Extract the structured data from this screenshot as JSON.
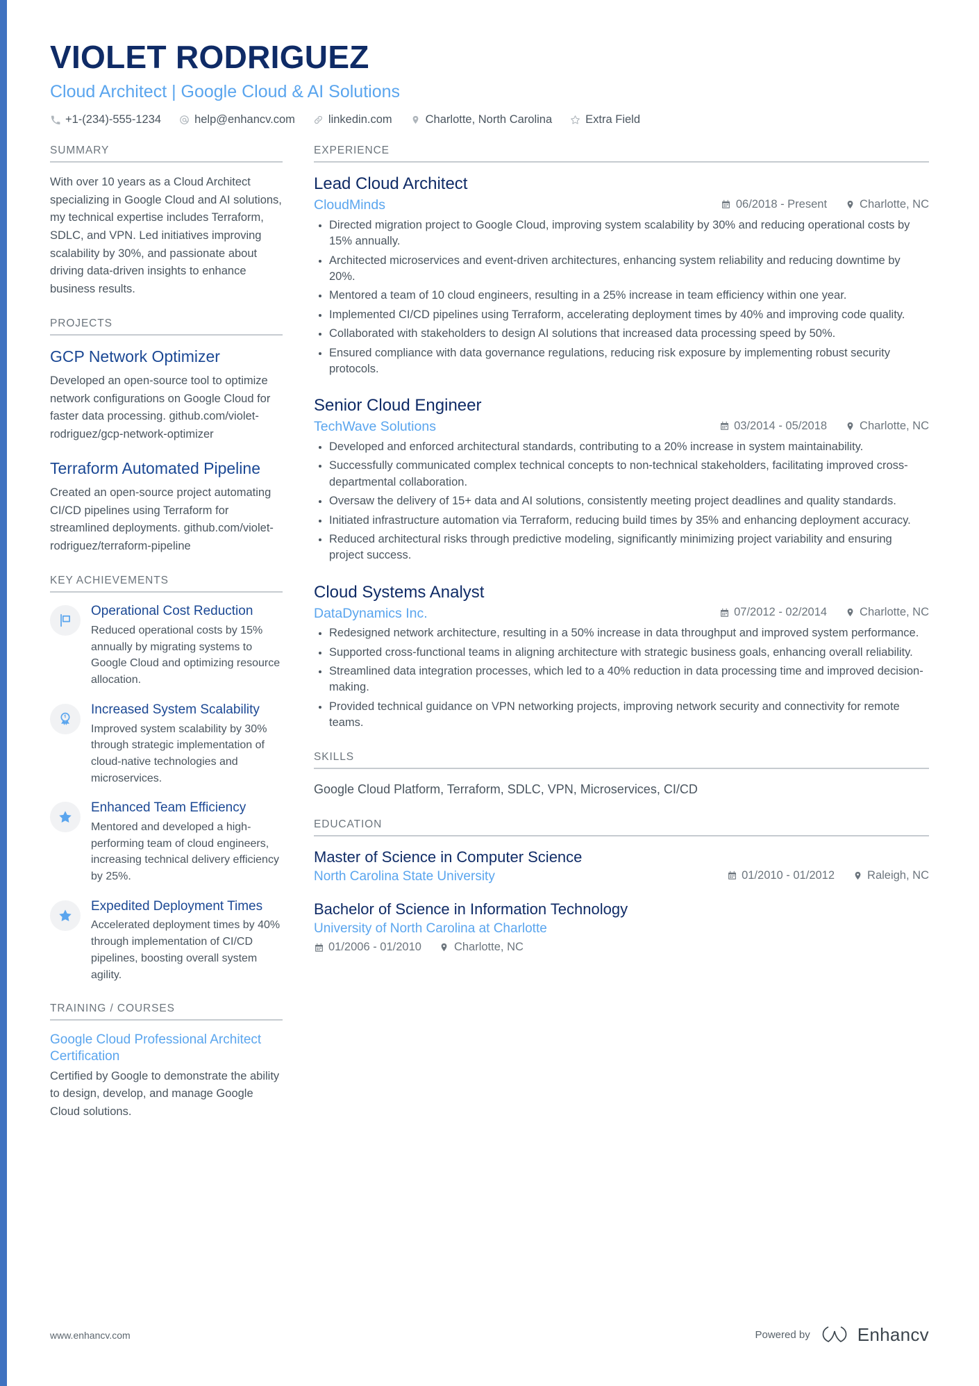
{
  "header": {
    "name": "VIOLET RODRIGUEZ",
    "role": "Cloud Architect | Google Cloud & AI Solutions",
    "contacts": [
      {
        "icon": "phone-icon",
        "text": "+1-(234)-555-1234"
      },
      {
        "icon": "email-icon",
        "text": "help@enhancv.com"
      },
      {
        "icon": "link-icon",
        "text": "linkedin.com"
      },
      {
        "icon": "location-pin-icon",
        "text": "Charlotte, North Carolina"
      },
      {
        "icon": "star-outline-icon",
        "text": "Extra Field"
      }
    ]
  },
  "summary": {
    "heading": "SUMMARY",
    "text": "With over 10 years as a Cloud Architect specializing in Google Cloud and AI solutions, my technical expertise includes Terraform, SDLC, and VPN. Led initiatives improving scalability by 30%, and passionate about driving data-driven insights to enhance business results."
  },
  "projects": {
    "heading": "PROJECTS",
    "items": [
      {
        "title": "GCP Network Optimizer",
        "description": "Developed an open-source tool to optimize network configurations on Google Cloud for faster data processing. github.com/violet-rodriguez/gcp-network-optimizer"
      },
      {
        "title": "Terraform Automated Pipeline",
        "description": "Created an open-source project automating CI/CD pipelines using Terraform for streamlined deployments. github.com/violet-rodriguez/terraform-pipeline"
      }
    ]
  },
  "achievements": {
    "heading": "KEY ACHIEVEMENTS",
    "items": [
      {
        "icon": "flag-icon",
        "title": "Operational Cost Reduction",
        "description": "Reduced operational costs by 15% annually by migrating systems to Google Cloud and optimizing resource allocation."
      },
      {
        "icon": "award-ribbon-icon",
        "title": "Increased System Scalability",
        "description": "Improved system scalability by 30% through strategic implementation of cloud-native technologies and microservices."
      },
      {
        "icon": "star-icon",
        "title": "Enhanced Team Efficiency",
        "description": "Mentored and developed a high-performing team of cloud engineers, increasing technical delivery efficiency by 25%."
      },
      {
        "icon": "star-icon",
        "title": "Expedited Deployment Times",
        "description": "Accelerated deployment times by 40% through implementation of CI/CD pipelines, boosting overall system agility."
      }
    ]
  },
  "training": {
    "heading": "TRAINING / COURSES",
    "items": [
      {
        "title": "Google Cloud Professional Architect Certification",
        "description": "Certified by Google to demonstrate the ability to design, develop, and manage Google Cloud solutions."
      }
    ]
  },
  "experience": {
    "heading": "EXPERIENCE",
    "jobs": [
      {
        "title": "Lead Cloud Architect",
        "company": "CloudMinds",
        "dates": "06/2018 - Present",
        "location": "Charlotte, NC",
        "bullets": [
          "Directed migration project to Google Cloud, improving system scalability by 30% and reducing operational costs by 15% annually.",
          "Architected microservices and event-driven architectures, enhancing system reliability and reducing downtime by 20%.",
          "Mentored a team of 10 cloud engineers, resulting in a 25% increase in team efficiency within one year.",
          "Implemented CI/CD pipelines using Terraform, accelerating deployment times by 40% and improving code quality.",
          "Collaborated with stakeholders to design AI solutions that increased data processing speed by 50%.",
          "Ensured compliance with data governance regulations, reducing risk exposure by implementing robust security protocols."
        ]
      },
      {
        "title": "Senior Cloud Engineer",
        "company": "TechWave Solutions",
        "dates": "03/2014 - 05/2018",
        "location": "Charlotte, NC",
        "bullets": [
          "Developed and enforced architectural standards, contributing to a 20% increase in system maintainability.",
          "Successfully communicated complex technical concepts to non-technical stakeholders, facilitating improved cross-departmental collaboration.",
          "Oversaw the delivery of 15+ data and AI solutions, consistently meeting project deadlines and quality standards.",
          "Initiated infrastructure automation via Terraform, reducing build times by 35% and enhancing deployment accuracy.",
          "Reduced architectural risks through predictive modeling, significantly minimizing project variability and ensuring project success."
        ]
      },
      {
        "title": "Cloud Systems Analyst",
        "company": "DataDynamics Inc.",
        "dates": "07/2012 - 02/2014",
        "location": "Charlotte, NC",
        "bullets": [
          "Redesigned network architecture, resulting in a 50% increase in data throughput and improved system performance.",
          "Supported cross-functional teams in aligning architecture with strategic business goals, enhancing overall reliability.",
          "Streamlined data integration processes, which led to a 40% reduction in data processing time and improved decision-making.",
          "Provided technical guidance on VPN networking projects, improving network security and connectivity for remote teams."
        ]
      }
    ]
  },
  "skills": {
    "heading": "SKILLS",
    "text": "Google Cloud Platform, Terraform, SDLC, VPN, Microservices, CI/CD"
  },
  "education": {
    "heading": "EDUCATION",
    "items": [
      {
        "degree": "Master of Science in Computer Science",
        "school": "North Carolina State University",
        "dates": "01/2010 - 01/2012",
        "location": "Raleigh, NC",
        "inline_meta": false
      },
      {
        "degree": "Bachelor of Science in Information Technology",
        "school": "University of North Carolina at Charlotte",
        "dates": "01/2006 - 01/2010",
        "location": "Charlotte, NC",
        "inline_meta": true
      }
    ]
  },
  "footer": {
    "website": "www.enhancv.com",
    "powered_by": "Powered by",
    "brand": "Enhancv"
  },
  "colors": {
    "accent_bar": "#3f72c0",
    "navy": "#0f2b66",
    "light_blue": "#5aa5ee",
    "body": "#4a555f",
    "muted": "#6c757d"
  }
}
